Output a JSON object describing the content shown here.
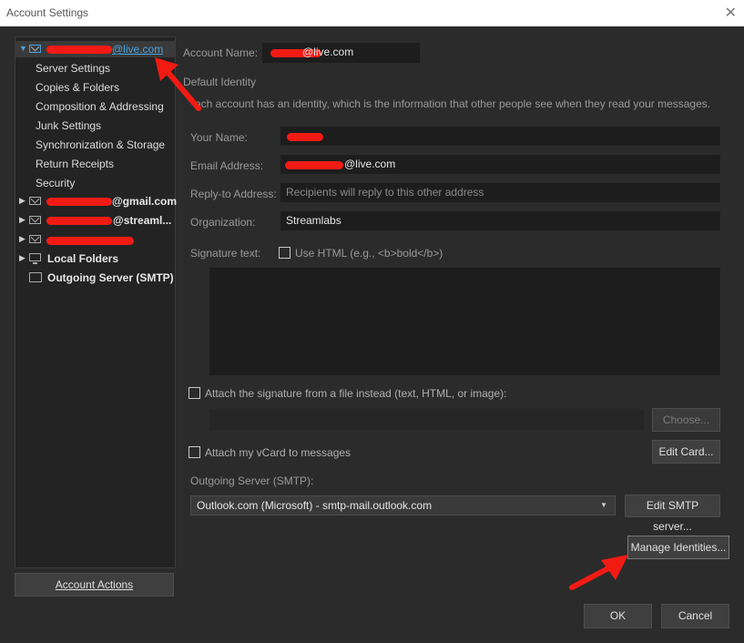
{
  "window": {
    "title": "Account Settings",
    "close_glyph": "✕"
  },
  "tree": {
    "selected_account_suffix": "@live.com",
    "sub_items": [
      "Server Settings",
      "Copies & Folders",
      "Composition & Addressing",
      "Junk Settings",
      "Synchronization & Storage",
      "Return Receipts",
      "Security"
    ],
    "gmail_suffix": "@gmail.com",
    "streamlabs_suffix": "@streaml...",
    "local_folders": "Local Folders",
    "outgoing_server": "Outgoing Server (SMTP)",
    "icons": [
      "envelope-icon",
      "monitor-icon",
      "outbox-icon"
    ]
  },
  "account_actions": "Account Actions",
  "form": {
    "account_name_label": "Account Name:",
    "account_name_value": "@live.com",
    "default_identity_title": "Default Identity",
    "identity_desc": "ach account has an identity, which is the information that other people see when they read your messages.",
    "your_name_label": "Your Name:",
    "your_name_value": "",
    "email_label": "Email Address:",
    "email_value": "@live.com",
    "replyto_label": "Reply-to Address:",
    "replyto_placeholder": "Recipients will reply to this other address",
    "org_label": "Organization:",
    "org_value": "Streamlabs",
    "signature_label": "Signature text:",
    "use_html_label": "Use HTML (e.g., <b>bold</b>)",
    "attach_sig_label": "Attach the signature from a file instead (text, HTML, or image):",
    "choose_button": "Choose...",
    "vcard_label": "Attach my vCard to messages",
    "edit_card_button": "Edit Card...",
    "smtp_label": "Outgoing Server (SMTP):",
    "smtp_value": "Outlook.com (Microsoft) - smtp-mail.outlook.com",
    "edit_smtp_button": "Edit SMTP server...",
    "manage_identities_button": "Manage Identities..."
  },
  "footer": {
    "ok": "OK",
    "cancel": "Cancel"
  },
  "colors": {
    "background": "#2b2b2b",
    "field": "#1d1d1d",
    "accent": "#4aa3df",
    "annotation": "#f21b14"
  }
}
